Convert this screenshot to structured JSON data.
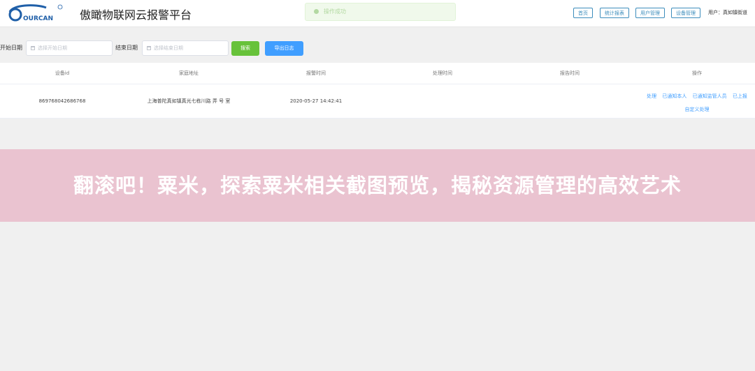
{
  "header": {
    "logo_text": "OURCAN",
    "title": "傲瞰物联网云报警平台",
    "toast": "操作成功",
    "nav": [
      "首页",
      "统计报表",
      "用户管理",
      "设备管理"
    ],
    "user": "用户：真如镇街道"
  },
  "filter": {
    "start_label": "开始日期",
    "start_placeholder": "选择开始日期",
    "end_label": "结束日期",
    "end_placeholder": "选择结束日期",
    "search_label": "搜索",
    "export_label": "导出日志"
  },
  "table": {
    "columns": [
      "设备id",
      "家庭地址",
      "报警时间",
      "处理时间",
      "报告时间",
      "操作"
    ],
    "rows": [
      {
        "device_id": "869768042686768",
        "address": "上海普陀真如镇真光七栋川路   弄   号   室",
        "alarm_time": "2020-05-27 14:42:41",
        "handle_time": "",
        "report_time": "",
        "actions": [
          "处理",
          "已通知本人",
          "已通知监管人员",
          "已上报",
          "自定义处理"
        ]
      }
    ]
  },
  "banner": {
    "text": "翻滚吧！粟米，探索粟米相关截图预览，揭秘资源管理的高效艺术"
  },
  "colors": {
    "primary": "#409eff",
    "success": "#67c23a",
    "nav_border": "#3c8dbc",
    "banner_bg": "#eac3d0"
  }
}
